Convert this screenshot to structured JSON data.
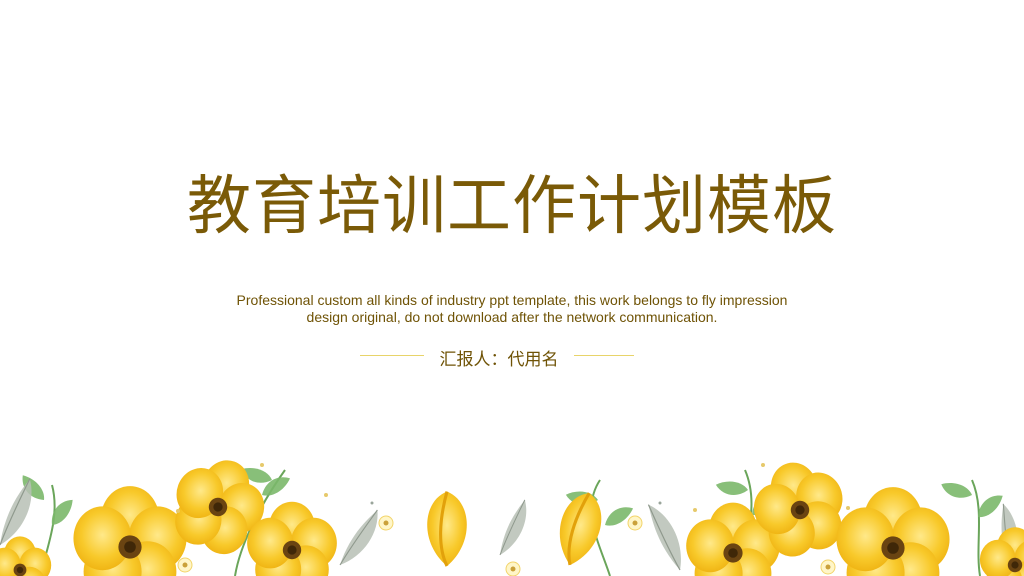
{
  "slide": {
    "title": "教育培训工作计划模板",
    "subtitle": "Professional custom all kinds of industry ppt template, this work belongs to fly impression design original, do not download after the network communication.",
    "reporter": "汇报人：代用名"
  },
  "colors": {
    "title": "#7a5a07",
    "text": "#6f5306",
    "rule": "#e8d46a",
    "petal": "#f6c225",
    "petal_light": "#fbdb5a",
    "leaf": "#6fae5e",
    "leaf_gray": "#9aa59b",
    "center": "#5a3a12"
  },
  "decor": {
    "icon": "watercolor-yellow-flowers-border"
  }
}
